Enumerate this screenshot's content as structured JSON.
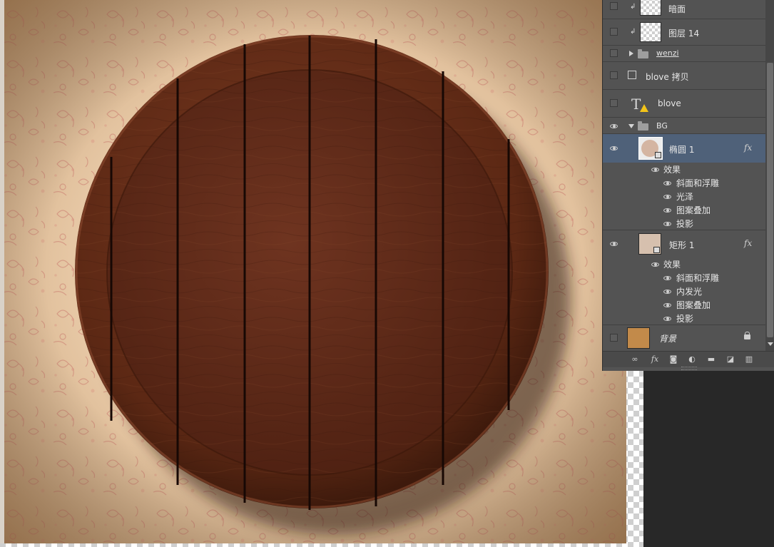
{
  "layers_panel": {
    "layers": [
      {
        "name": "暗面",
        "type": "pixel",
        "clipped": true,
        "visible": false
      },
      {
        "name": "图层 14",
        "type": "pixel",
        "clipped": true,
        "visible": false
      },
      {
        "name": "wenzi",
        "type": "group",
        "collapsed": true,
        "visible": false
      },
      {
        "name": "blove 拷贝",
        "type": "smart-shape",
        "visible": false
      },
      {
        "name": "blove",
        "type": "text",
        "warning": true,
        "visible": false
      },
      {
        "name": "BG",
        "type": "group",
        "collapsed": false,
        "visible": true
      },
      {
        "name": "椭圆 1",
        "type": "shape",
        "selected": true,
        "visible": true,
        "fx": "fx",
        "effects_label": "效果",
        "effects": [
          "斜面和浮雕",
          "光泽",
          "图案叠加",
          "投影"
        ]
      },
      {
        "name": "矩形 1",
        "type": "shape",
        "visible": true,
        "fx": "fx",
        "effects_label": "效果",
        "effects": [
          "斜面和浮雕",
          "内发光",
          "图案叠加",
          "投影"
        ]
      },
      {
        "name": "背景",
        "type": "background",
        "locked": true,
        "visible": false
      }
    ],
    "toolbar_icons": [
      "link-icon",
      "fx-icon",
      "mask-icon",
      "adjustment-icon",
      "folder-icon",
      "new-layer-icon",
      "trash-icon"
    ],
    "toolbar_fx_label": "fx"
  },
  "colors": {
    "panel_bg": "#535353",
    "selection": "#4f6179",
    "wood_dark": "#4a1f10",
    "wood_mid": "#6e3520",
    "background_swatch": "#c28a4a",
    "paper": "#e9cdac"
  }
}
